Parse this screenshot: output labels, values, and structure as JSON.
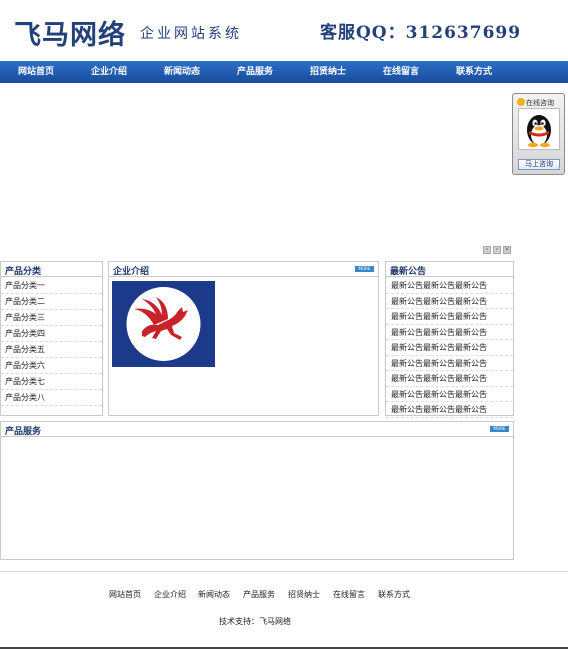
{
  "header": {
    "site_name": "飞马网络",
    "tagline": "企业网站系统",
    "qq_label": "客服QQ：312637699"
  },
  "nav": {
    "items": [
      "网站首页",
      "企业介绍",
      "新闻动态",
      "产品服务",
      "招贤纳士",
      "在线留言",
      "联系方式"
    ]
  },
  "qq_float": {
    "title": "在线咨询",
    "button": "马上咨询"
  },
  "slider": {
    "controls": [
      "‹",
      "›",
      "×"
    ]
  },
  "categories": {
    "title": "产品分类",
    "items": [
      "产品分类一",
      "产品分类二",
      "产品分类三",
      "产品分类四",
      "产品分类五",
      "产品分类六",
      "产品分类七",
      "产品分类八"
    ]
  },
  "about": {
    "title": "企业介绍",
    "more": "MORE"
  },
  "notices": {
    "title": "最新公告",
    "items": [
      "最新公告最新公告最新公告",
      "最新公告最新公告最新公告",
      "最新公告最新公告最新公告",
      "最新公告最新公告最新公告",
      "最新公告最新公告最新公告",
      "最新公告最新公告最新公告",
      "最新公告最新公告最新公告",
      "最新公告最新公告最新公告",
      "最新公告最新公告最新公告"
    ]
  },
  "products": {
    "title": "产品服务",
    "more": "MORE"
  },
  "footer": {
    "nav": [
      "网站首页",
      "企业介绍",
      "新闻动态",
      "产品服务",
      "招贤纳士",
      "在线留言",
      "联系方式"
    ],
    "support": "技术支持：飞马网络"
  },
  "colors": {
    "brand": "#23407a",
    "nav_bar": "#1f5bb0",
    "more_button": "#3b86c8",
    "logo_bg": "#1d3a8a",
    "logo_horse": "#c8232a"
  },
  "icons": {
    "qq": "qq-penguin-icon",
    "logo": "pegasus-logo"
  }
}
